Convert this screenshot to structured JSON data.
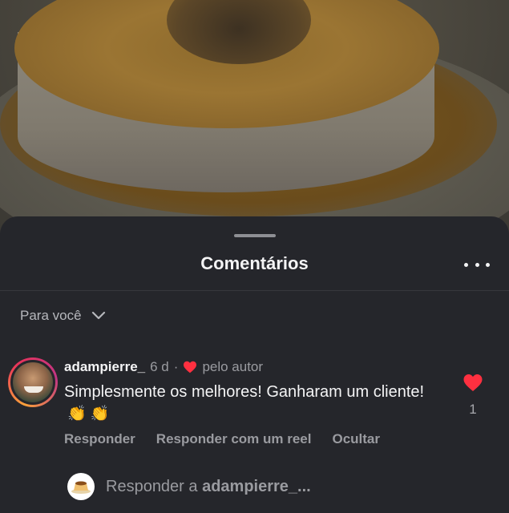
{
  "sheet": {
    "title": "Comentários",
    "more_icon": "more-horizontal-icon",
    "sort_label": "Para você"
  },
  "comment": {
    "username": "adampierre_",
    "age": "6 d",
    "separator": "·",
    "liked_by_author_label": "pelo autor",
    "text": "Simplesmente os melhores! Ganharam um cliente!",
    "emojis": "👏 👏",
    "like_count": "1",
    "actions": [
      "Responder",
      "Responder com um reel",
      "Ocultar"
    ],
    "heart_color": "#ff3040"
  },
  "reply": {
    "prefix": "Responder a ",
    "target": "adampierre_..."
  }
}
